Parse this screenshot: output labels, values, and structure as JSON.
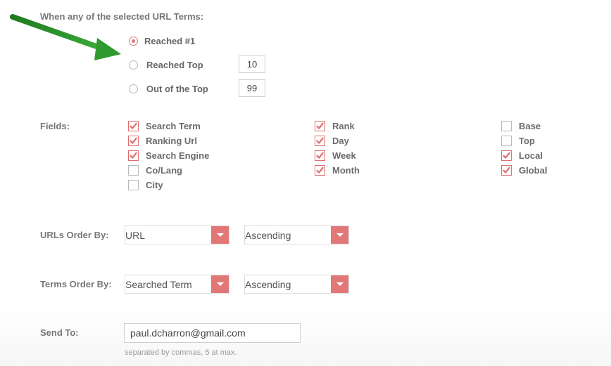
{
  "header": {
    "label": "When any of the selected URL Terms:"
  },
  "radios": [
    {
      "label": "Reached #1",
      "checked": true
    },
    {
      "label": "Reached Top",
      "checked": false,
      "value": "10"
    },
    {
      "label": "Out of the Top",
      "checked": false,
      "value": "99"
    }
  ],
  "fields": {
    "label": "Fields:",
    "col1": [
      {
        "label": "Search Term",
        "checked": true
      },
      {
        "label": "Ranking Url",
        "checked": true
      },
      {
        "label": "Search Engine",
        "checked": true
      },
      {
        "label": "Co/Lang",
        "checked": false
      },
      {
        "label": "City",
        "checked": false
      }
    ],
    "col2": [
      {
        "label": "Rank",
        "checked": true
      },
      {
        "label": "Day",
        "checked": true
      },
      {
        "label": "Week",
        "checked": true
      },
      {
        "label": "Month",
        "checked": true
      }
    ],
    "col3": [
      {
        "label": "Base",
        "checked": false
      },
      {
        "label": "Top",
        "checked": false
      },
      {
        "label": "Local",
        "checked": true
      },
      {
        "label": "Global",
        "checked": true
      }
    ]
  },
  "urls_order": {
    "label": "URLs Order By:",
    "field": "URL",
    "direction": "Ascending"
  },
  "terms_order": {
    "label": "Terms Order By:",
    "field": "Searched Term",
    "direction": "Ascending"
  },
  "send_to": {
    "label": "Send To:",
    "value": "paul.dcharron@gmail.com",
    "hint": "separated by commas, 5 at max."
  },
  "colors": {
    "accent": "#e27777",
    "arrow": "#2e8b2e"
  }
}
